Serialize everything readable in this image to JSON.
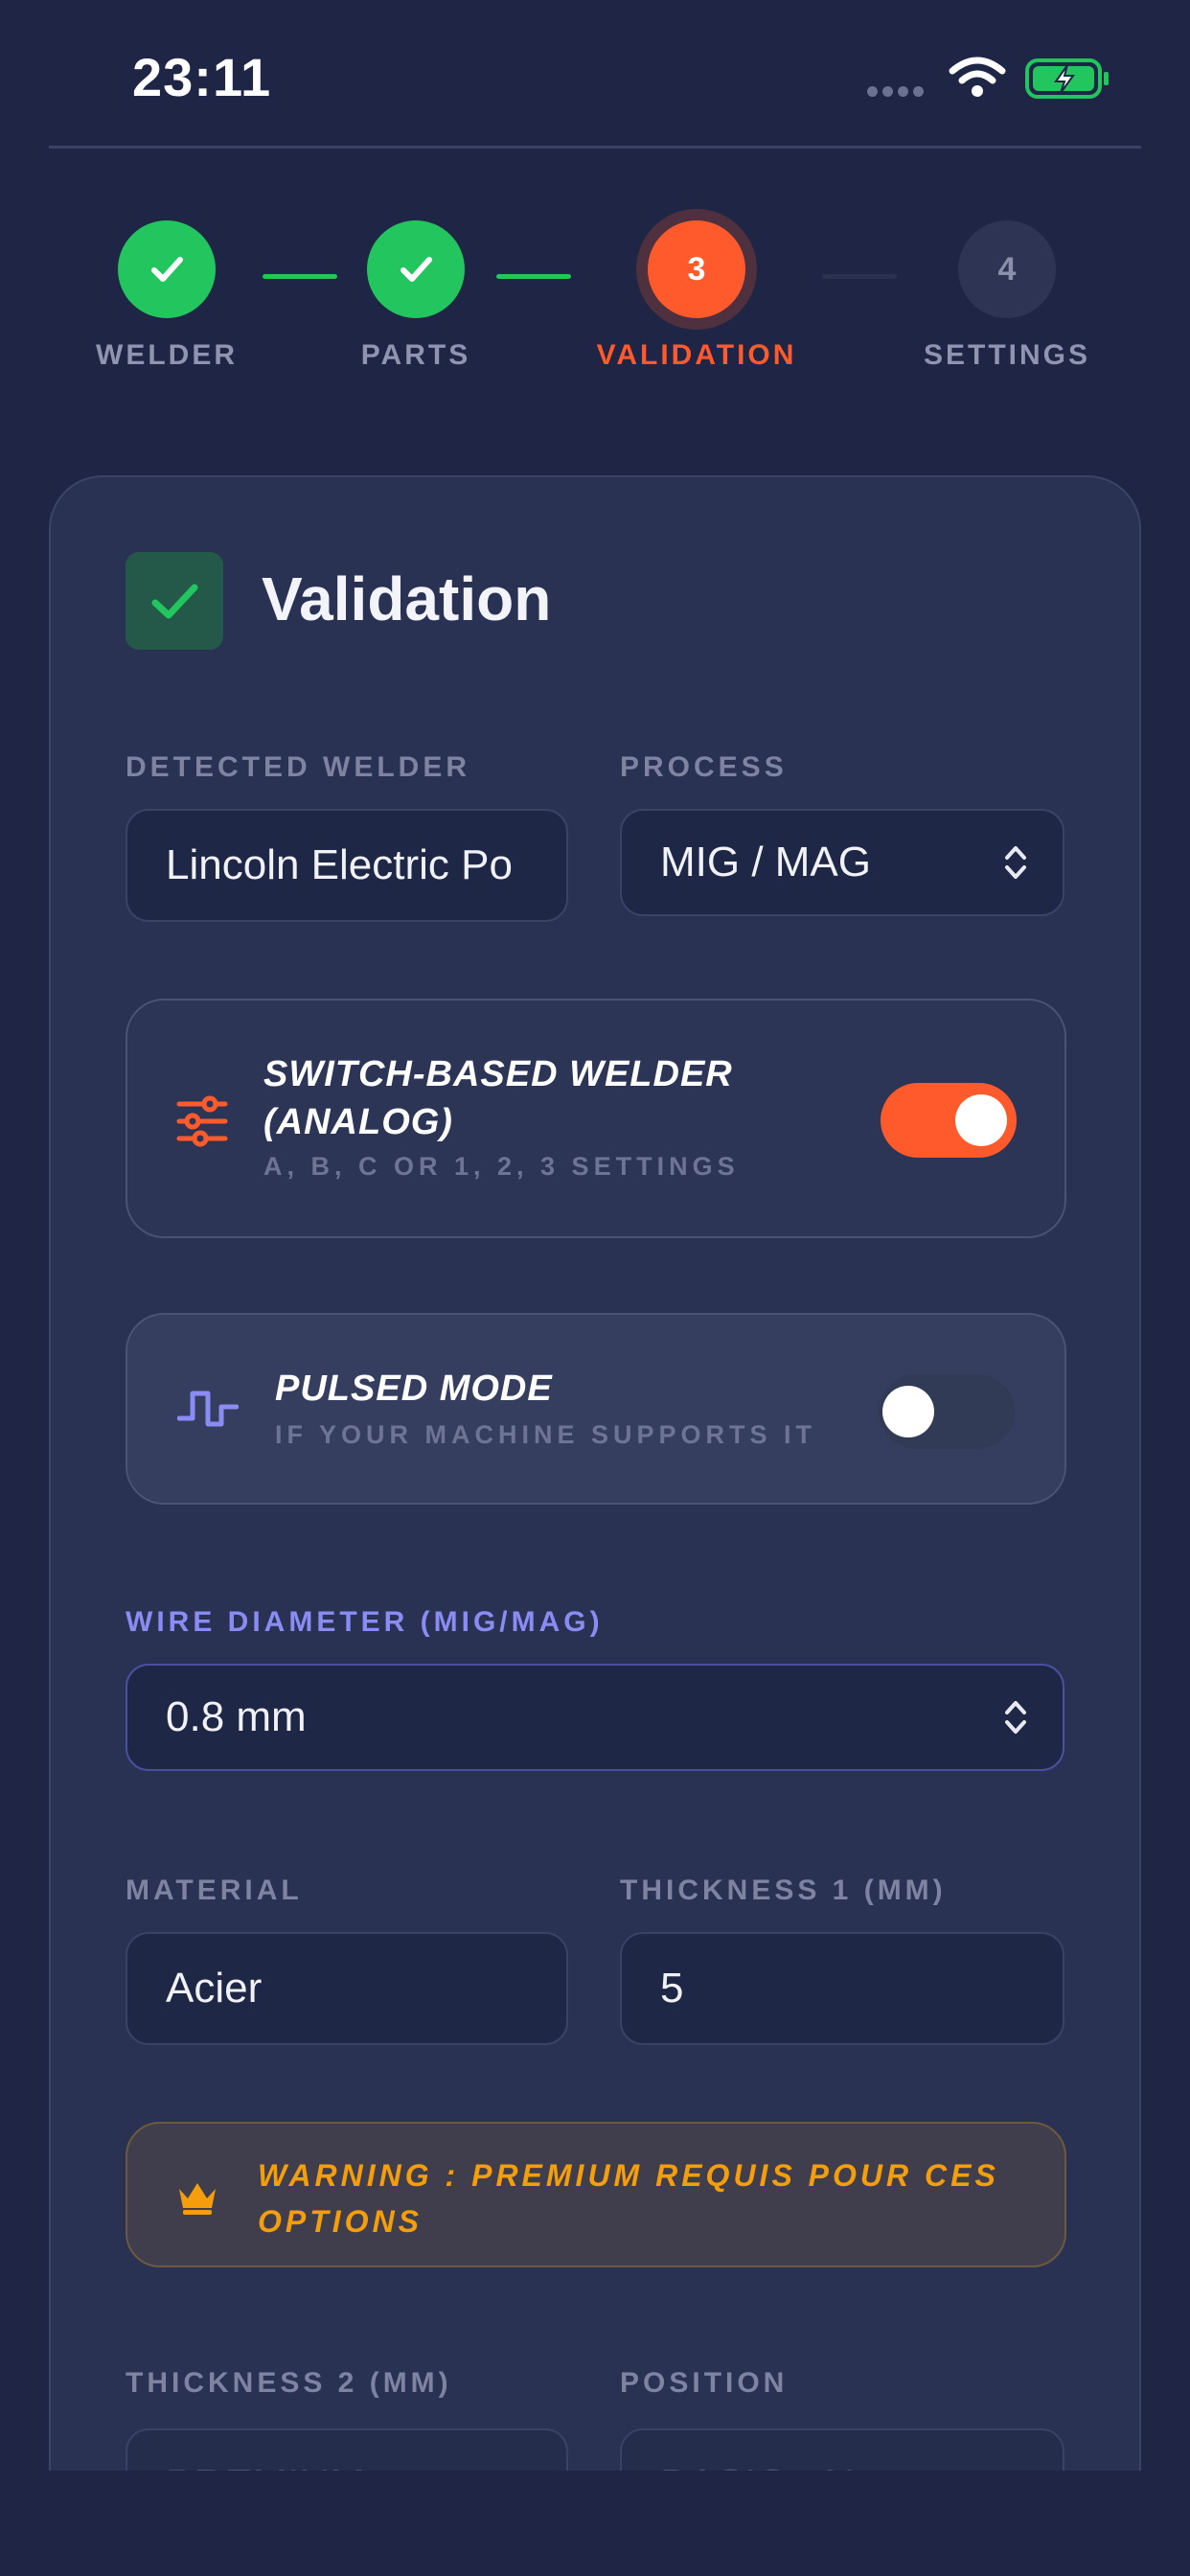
{
  "status_bar": {
    "time": "23:11"
  },
  "stepper": {
    "steps": [
      {
        "label": "WELDER",
        "state": "done"
      },
      {
        "label": "PARTS",
        "state": "done"
      },
      {
        "label": "VALIDATION",
        "state": "active",
        "number": "3"
      },
      {
        "label": "SETTINGS",
        "state": "pending",
        "number": "4"
      }
    ]
  },
  "card": {
    "title": "Validation",
    "detected_welder": {
      "label": "DETECTED WELDER",
      "value": "Lincoln Electric Po"
    },
    "process": {
      "label": "PROCESS",
      "value": "MIG / MAG"
    },
    "switch_welder": {
      "title": "SWITCH-BASED WELDER (ANALOG)",
      "subtitle": "A, B, C OR 1, 2, 3 SETTINGS",
      "enabled": true
    },
    "pulsed_mode": {
      "title": "PULSED MODE",
      "subtitle": "IF YOUR MACHINE SUPPORTS IT",
      "enabled": false
    },
    "wire_diameter": {
      "label": "WIRE DIAMETER (MIG/MAG)",
      "value": "0.8 mm"
    },
    "material": {
      "label": "MATERIAL",
      "value": "Acier"
    },
    "thickness1": {
      "label": "THICKNESS 1 (MM)",
      "value": "5"
    },
    "warning": {
      "text": "WARNING : PREMIUM REQUIS POUR CES OPTIONS"
    },
    "thickness2": {
      "label": "THICKNESS 2 (MM)",
      "value": "PREMIUM"
    },
    "position": {
      "label": "POSITION",
      "value": "BASIC - N..."
    }
  },
  "colors": {
    "accent": "#ff5a2c",
    "success": "#22c55e",
    "indigo": "#8b8cf3",
    "warning": "#f59e0b",
    "background": "#1e2545"
  }
}
